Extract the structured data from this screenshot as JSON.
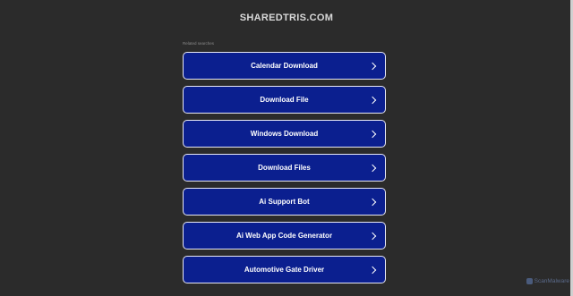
{
  "site": {
    "title": "SHAREDTRIS.COM"
  },
  "related": {
    "label": "Related searches",
    "items": [
      {
        "label": "Calendar Download"
      },
      {
        "label": "Download File"
      },
      {
        "label": "Windows Download"
      },
      {
        "label": "Download Files"
      },
      {
        "label": "Ai Support Bot"
      },
      {
        "label": "Ai Web App Code Generator"
      },
      {
        "label": "Automotive Gate Driver"
      }
    ]
  },
  "badge": {
    "label": "ScanMalware"
  },
  "colors": {
    "background": "#2b2b2b",
    "button_fill": "#0b1f8f",
    "button_border": "#e8e8f4",
    "title_text": "#d9d9d9"
  }
}
